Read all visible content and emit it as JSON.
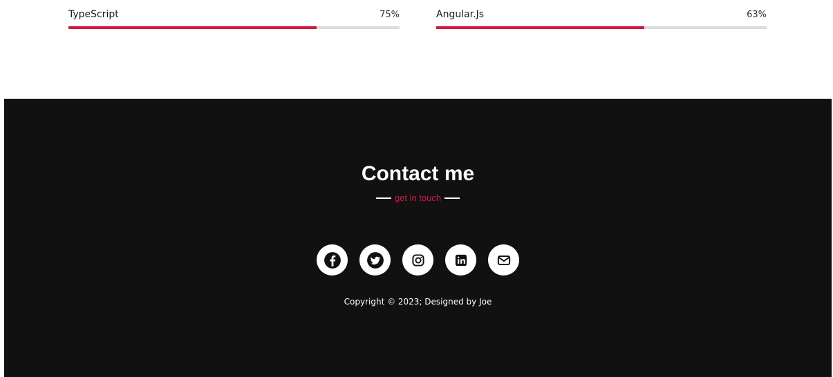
{
  "skills": [
    {
      "name": "TypeScript",
      "percent_label": "75%",
      "level": 0.75
    },
    {
      "name": "Angular.Js",
      "percent_label": "63%",
      "level": 0.63
    }
  ],
  "contact": {
    "title": "Contact me",
    "subtitle": "get in touch"
  },
  "socials": [
    {
      "name": "facebook",
      "icon": "facebook-icon"
    },
    {
      "name": "twitter",
      "icon": "twitter-icon"
    },
    {
      "name": "instagram",
      "icon": "instagram-icon"
    },
    {
      "name": "linkedin",
      "icon": "linkedin-icon"
    },
    {
      "name": "email",
      "icon": "envelope-icon"
    }
  ],
  "copyright": "Copyright © 2023; Designed by Joe",
  "colors": {
    "accent": "#d11a45",
    "footer_bg": "#111111",
    "track": "#dcdcdc"
  }
}
